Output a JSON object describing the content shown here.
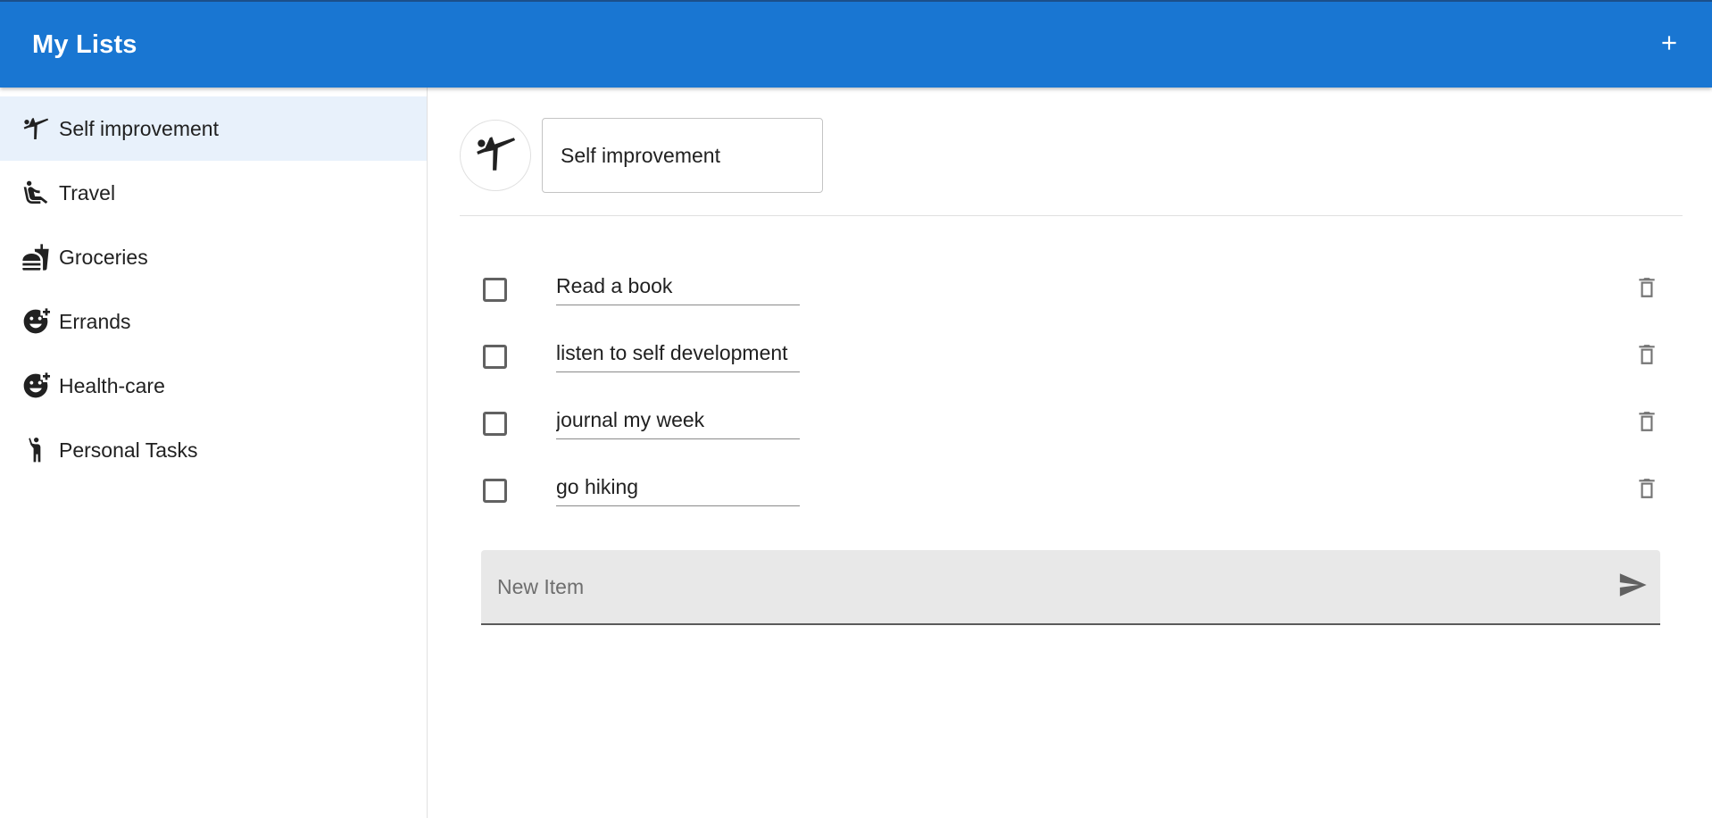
{
  "appbar": {
    "title": "My Lists",
    "add_icon": "plus-icon",
    "color": "#1976d2"
  },
  "sidebar": {
    "items": [
      {
        "label": "Self improvement",
        "icon": "kicking-person-icon",
        "active": true
      },
      {
        "label": "Travel",
        "icon": "airline-seat-icon",
        "active": false
      },
      {
        "label": "Groceries",
        "icon": "fastfood-icon",
        "active": false
      },
      {
        "label": "Errands",
        "icon": "add-reaction-icon",
        "active": false
      },
      {
        "label": "Health-care",
        "icon": "add-reaction-icon",
        "active": false
      },
      {
        "label": "Personal Tasks",
        "icon": "hiking-person-icon",
        "active": false
      }
    ]
  },
  "list": {
    "icon": "kicking-person-icon",
    "name": "Self improvement",
    "items": [
      {
        "text": "Read a book",
        "checked": false
      },
      {
        "text": "listen to self development",
        "checked": false
      },
      {
        "text": "journal my week",
        "checked": false
      },
      {
        "text": "go hiking",
        "checked": false
      }
    ],
    "new_item_placeholder": "New Item",
    "delete_icon": "trash-icon",
    "send_icon": "send-icon"
  }
}
